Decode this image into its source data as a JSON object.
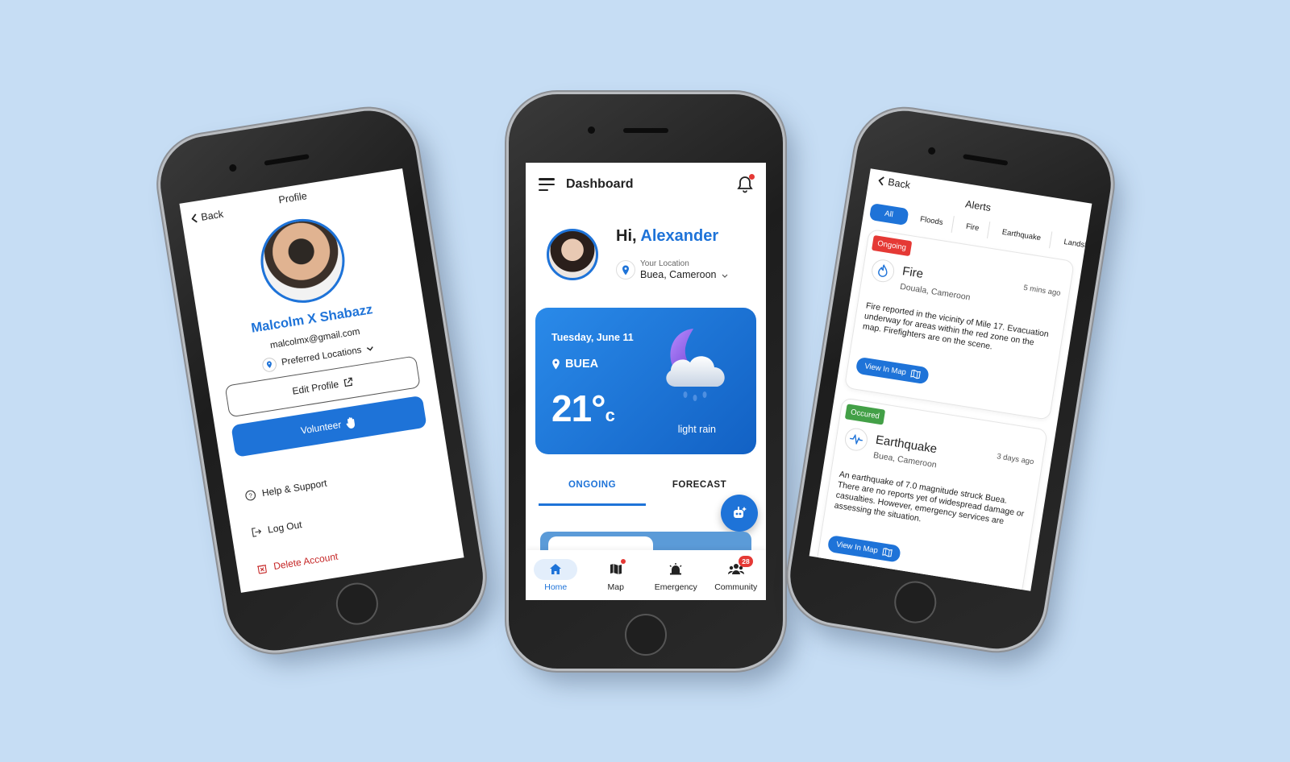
{
  "left_phone": {
    "back_label": "Back",
    "title": "Profile",
    "name": "Malcolm X Shabazz",
    "email": "malcolmx@gmail.com",
    "preferred_locations": "Preferred Locations",
    "edit_profile": "Edit Profile",
    "volunteer": "Volunteer",
    "menu": [
      {
        "label": "Help & Support",
        "icon": "help-icon"
      },
      {
        "label": "Log Out",
        "icon": "logout-icon"
      },
      {
        "label": "Delete Account",
        "icon": "delete-icon"
      }
    ]
  },
  "center_phone": {
    "header_title": "Dashboard",
    "greeting": "Hi,",
    "user_name": "Alexander",
    "location_label": "Your Location",
    "location_value": "Buea, Cameroon",
    "weather": {
      "date": "Tuesday, June 11",
      "city": "BUEA",
      "temp": "21°",
      "unit": "c",
      "condition": "light rain"
    },
    "tabs": [
      "ONGOING",
      "FORECAST"
    ],
    "nav": [
      {
        "label": "Home",
        "icon": "home-icon"
      },
      {
        "label": "Map",
        "icon": "map-icon"
      },
      {
        "label": "Emergency",
        "icon": "siren-icon"
      },
      {
        "label": "Community",
        "icon": "community-icon"
      }
    ],
    "community_badge": "28"
  },
  "right_phone": {
    "back_label": "Back",
    "title": "Alerts",
    "chips": [
      "All",
      "Floods",
      "Fire",
      "Earthquake",
      "Landslid"
    ],
    "alerts": [
      {
        "status": "Ongoing",
        "ago": "5 mins ago",
        "title": "Fire",
        "location": "Douala, Cameroon",
        "description": "Fire reported in the vicinity of Mile 17. Evacuation underway for areas within the red zone on the map. Firefighters are on the scene.",
        "button": "View In Map"
      },
      {
        "status": "Occured",
        "ago": "3 days ago",
        "title": "Earthquake",
        "location": "Buea, Cameroon",
        "description": "An earthquake of 7.0 magnitude struck Buea. There are no reports yet of widespread damage or casualties. However, emergency services are assessing the situation.",
        "button": "View In Map"
      }
    ]
  },
  "colors": {
    "background": "#c6ddf4",
    "accent": "#1e73d8",
    "ongoing": "#e53935",
    "occured": "#43a047",
    "danger": "#c62828"
  }
}
